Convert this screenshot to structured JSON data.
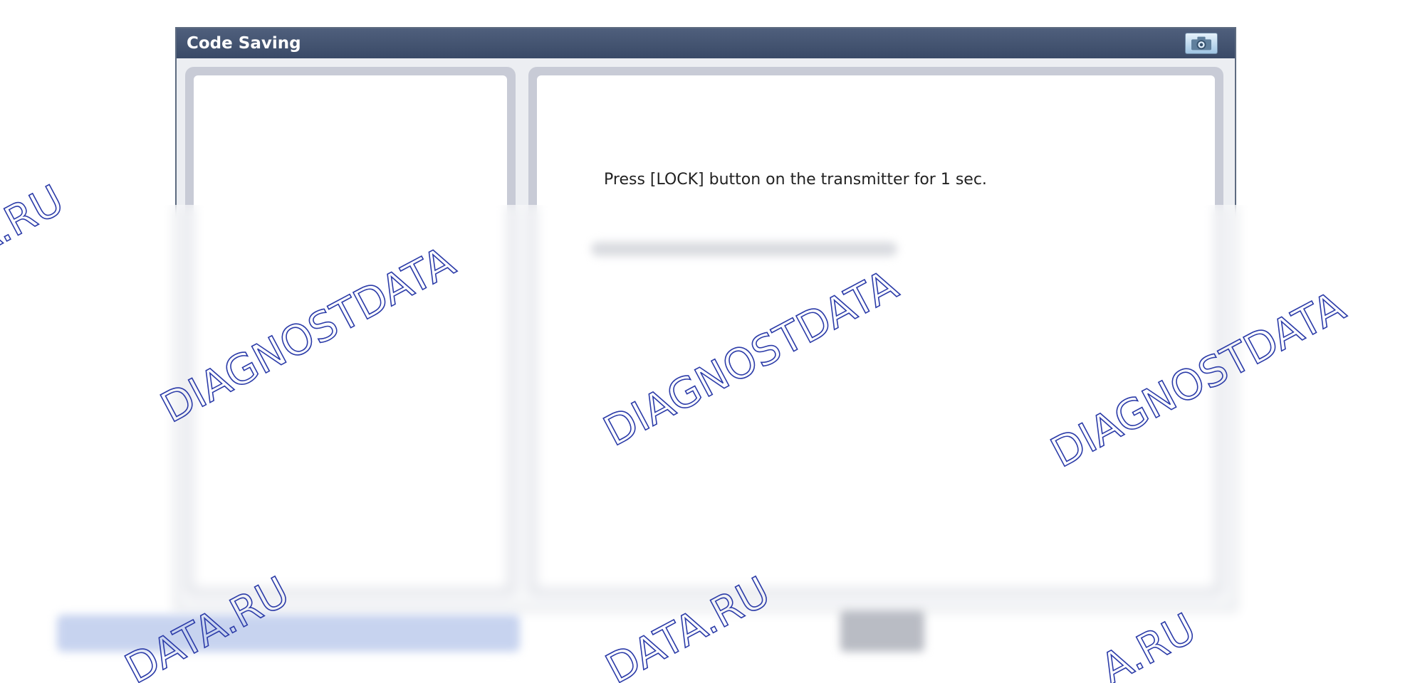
{
  "window": {
    "title": "Code Saving"
  },
  "right_panel": {
    "instruction": "Press [LOCK] button on the transmitter for 1 sec."
  },
  "icons": {
    "camera": "camera-icon"
  },
  "watermark": {
    "text_long": "DIAGNOSTDATA",
    "text_ru": "DATA.RU",
    "text_tail": "A.RU",
    "color": "#2b3ba8"
  }
}
